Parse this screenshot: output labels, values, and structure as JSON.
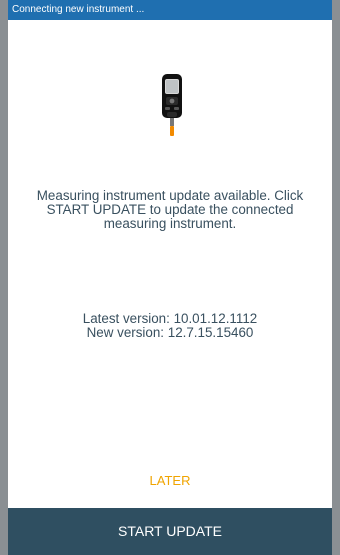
{
  "status_bar": {
    "title": "Connecting new instrument ..."
  },
  "device": {
    "icon": "measuring-instrument-icon",
    "colors": {
      "body": "#111111",
      "screen": "#d8d8d8",
      "button": "#f28a00"
    }
  },
  "message": {
    "text": "Measuring instrument update available. Click START UPDATE to update the connected measuring instrument."
  },
  "versions": {
    "latest": "Latest version: 10.01.12.1112",
    "new": "New version: 12.7.15.15460"
  },
  "actions": {
    "later_label": "LATER",
    "start_update_label": "START UPDATE"
  },
  "colors": {
    "status_bar": "#1f6fb0",
    "accent": "#f0a400",
    "primary_button": "#2f4f61",
    "text": "#39505f",
    "frame": "#8a8f93"
  }
}
